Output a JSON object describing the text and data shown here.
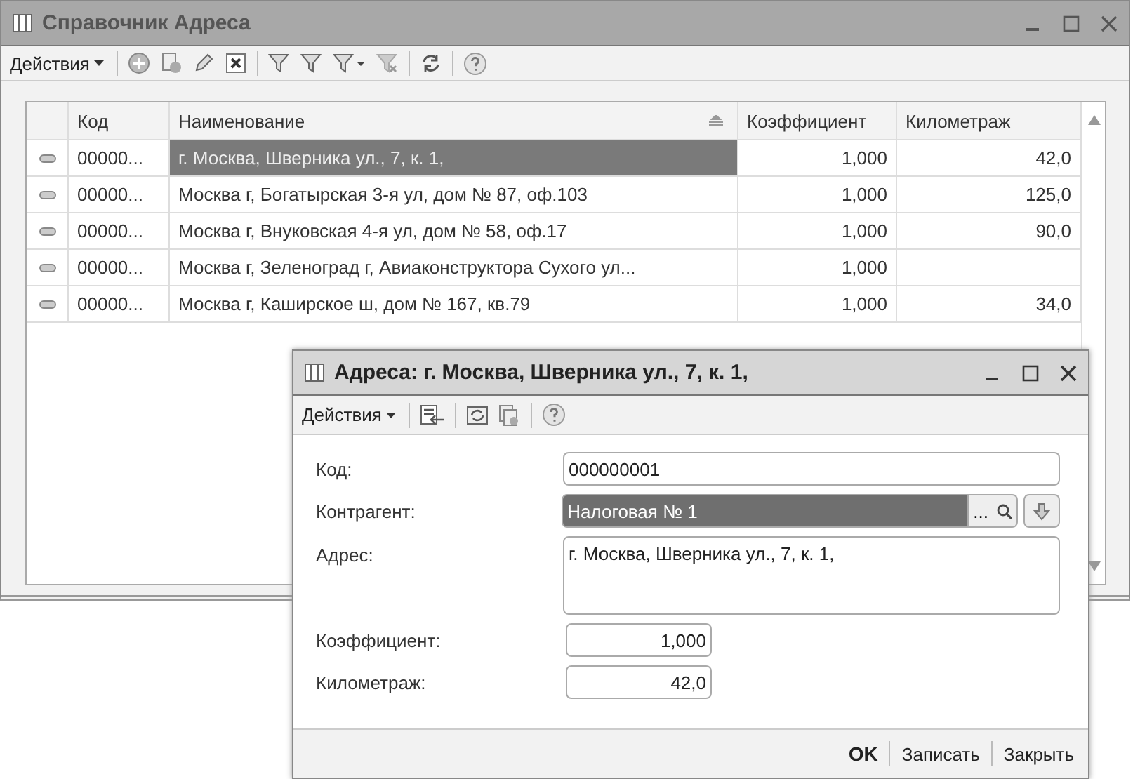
{
  "window": {
    "title": "Справочник Адреса"
  },
  "toolbar": {
    "actions_label": "Действия"
  },
  "table": {
    "columns": [
      "Код",
      "Наименование",
      "Коэффициент",
      "Километраж"
    ],
    "rows": [
      {
        "code": "00000...",
        "name": "г. Москва, Шверника ул., 7, к. 1,",
        "coefficient": "1,000",
        "mileage": "42,0",
        "selected": true
      },
      {
        "code": "00000...",
        "name": "Москва г, Богатырская 3-я ул, дом № 87, оф.103",
        "coefficient": "1,000",
        "mileage": "125,0",
        "selected": false
      },
      {
        "code": "00000...",
        "name": "Москва г, Внуковская 4-я ул, дом № 58, оф.17",
        "coefficient": "1,000",
        "mileage": "90,0",
        "selected": false
      },
      {
        "code": "00000...",
        "name": "Москва г, Зеленоград г, Авиаконструктора Сухого ул...",
        "coefficient": "1,000",
        "mileage": "",
        "selected": false
      },
      {
        "code": "00000...",
        "name": "Москва г, Каширское ш, дом № 167, кв.79",
        "coefficient": "1,000",
        "mileage": "34,0",
        "selected": false
      }
    ]
  },
  "dialog": {
    "title": "Адреса: г. Москва, Шверника ул., 7, к. 1,",
    "actions_label": "Действия",
    "fields": [
      {
        "kind": "text",
        "label": "Код:",
        "value": "000000001"
      },
      {
        "kind": "lookup",
        "label": "Контрагент:",
        "value": "Налоговая № 1",
        "ellipsis": "..."
      },
      {
        "kind": "memo",
        "label": "Адрес:",
        "value": "г. Москва, Шверника ул., 7, к. 1,"
      },
      {
        "kind": "number",
        "label": "Коэффициент:",
        "value": "1,000"
      },
      {
        "kind": "number",
        "label": "Километраж:",
        "value": "42,0"
      }
    ],
    "buttons": [
      "OK",
      "Записать",
      "Закрыть"
    ]
  }
}
